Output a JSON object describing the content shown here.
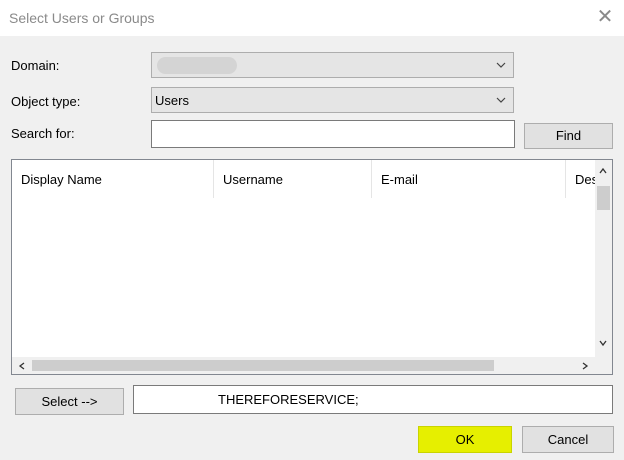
{
  "window": {
    "title": "Select Users or Groups",
    "close_symbol": "✕"
  },
  "domain": {
    "label": "Domain:",
    "value": ""
  },
  "object_type": {
    "label": "Object type:",
    "value": "Users"
  },
  "search": {
    "label": "Search for:",
    "value": "",
    "find_label": "Find"
  },
  "results": {
    "columns": [
      "Display Name",
      "Username",
      "E-mail",
      "Des"
    ]
  },
  "selection": {
    "select_label": "Select -->",
    "selected_value": "THEREFORESERVICE;"
  },
  "footer": {
    "ok_label": "OK",
    "cancel_label": "Cancel"
  },
  "colors": {
    "ok_highlight": "#e6ef00",
    "control_border": "#adadad"
  }
}
